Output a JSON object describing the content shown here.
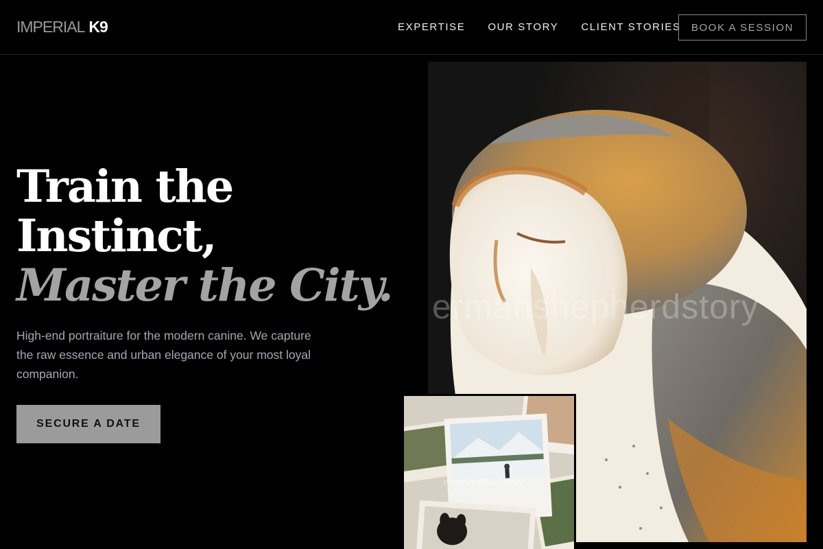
{
  "header": {
    "logo_light": "IMPERIAL",
    "logo_bold": "K9",
    "nav": [
      {
        "label": "EXPERTISE"
      },
      {
        "label": "OUR STORY"
      },
      {
        "label": "CLIENT STORIES"
      }
    ],
    "cta_label": "BOOK A SESSION"
  },
  "hero": {
    "title_line1": "Train the",
    "title_line2": "Instinct,",
    "title_line3": "Master the City.",
    "subtitle": "High-end portraiture for the modern canine. We capture the raw essence and urban elegance of your most loyal companion.",
    "cta_label": "SECURE A DATE"
  },
  "media": {
    "main_photo_watermark": "ermanshepherdstory",
    "inset_photo_watermark": "rmanshepherd.story"
  },
  "colors": {
    "background": "#000000",
    "accent_gray": "#a3a3a3",
    "cta_bg": "#9b9b9b",
    "subtitle": "#a4a8b3"
  }
}
